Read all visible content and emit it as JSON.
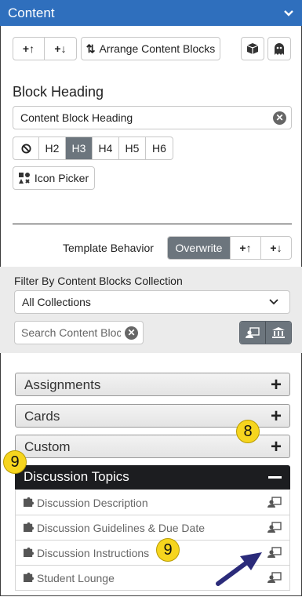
{
  "header": {
    "title": "Content",
    "chevron_icon": "chevron-down-icon"
  },
  "toolbar": {
    "move_up_label": "+↑",
    "move_down_label": "+↓",
    "arrange_icon": "sort-arrows-icon",
    "arrange_label": "Arrange Content Blocks",
    "right_icons": [
      "boxes-icon",
      "ghost-icon"
    ]
  },
  "block_heading": {
    "label": "Block Heading",
    "value": "Content Block Heading",
    "levels": [
      "H2",
      "H3",
      "H4",
      "H5",
      "H6"
    ],
    "selected": "H3",
    "icon_picker_label": "Icon Picker"
  },
  "template": {
    "label": "Template Behavior",
    "options": [
      "Overwrite",
      "+↑",
      "+↓"
    ],
    "selected": "Overwrite"
  },
  "filter": {
    "label": "Filter By Content Blocks Collection",
    "collection_value": "All Collections",
    "search_placeholder": "Search Content Blocks"
  },
  "accordion": {
    "sections": [
      {
        "title": "Assignments"
      },
      {
        "title": "Cards"
      },
      {
        "title": "Custom"
      }
    ],
    "open_section": {
      "title": "Discussion Topics",
      "items": [
        "Discussion Description",
        "Discussion Guidelines & Due Date",
        "Discussion Instructions",
        "Student Lounge"
      ]
    }
  },
  "annotations": {
    "badge_a": "8",
    "badge_b": "9",
    "badge_c": "9"
  },
  "colors": {
    "header": "#2f6fbd",
    "active": "#6c757d",
    "open_section": "#1c1d20",
    "badge": "#f6d51e",
    "arrow": "#2b2b7a"
  }
}
